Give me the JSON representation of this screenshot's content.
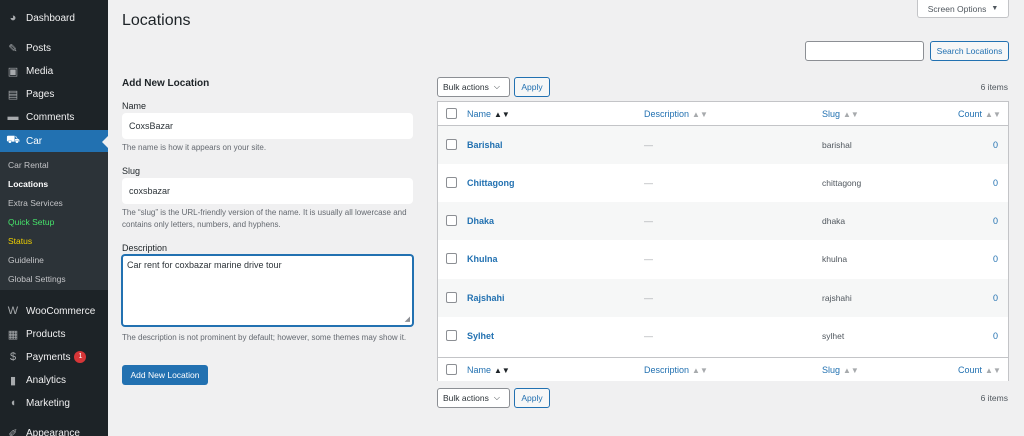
{
  "sidebar": {
    "menu": [
      {
        "label": "Dashboard",
        "icon": "dashboard-icon",
        "glyph": "◕"
      },
      {
        "label": "Posts",
        "icon": "pin-icon",
        "glyph": "✎"
      },
      {
        "label": "Media",
        "icon": "media-icon",
        "glyph": "▣"
      },
      {
        "label": "Pages",
        "icon": "pages-icon",
        "glyph": "▤"
      },
      {
        "label": "Comments",
        "icon": "comments-icon",
        "glyph": "▬"
      },
      {
        "label": "Car",
        "icon": "car-icon",
        "glyph": "⛟"
      }
    ],
    "submenu": [
      {
        "label": "Car Rental"
      },
      {
        "label": "Locations"
      },
      {
        "label": "Extra Services"
      },
      {
        "label": "Quick Setup"
      },
      {
        "label": "Status"
      },
      {
        "label": "Guideline"
      },
      {
        "label": "Global Settings"
      }
    ],
    "menu2": [
      {
        "label": "WooCommerce",
        "icon": "woocommerce-icon",
        "glyph": "W"
      },
      {
        "label": "Products",
        "icon": "products-icon",
        "glyph": "▦"
      },
      {
        "label": "Payments",
        "icon": "payments-icon",
        "glyph": "$",
        "badge": "1"
      },
      {
        "label": "Analytics",
        "icon": "analytics-icon",
        "glyph": "▮"
      },
      {
        "label": "Marketing",
        "icon": "marketing-icon",
        "glyph": "◖"
      },
      {
        "label": "Appearance",
        "icon": "appearance-icon",
        "glyph": "✐"
      }
    ]
  },
  "header": {
    "title": "Locations",
    "screen_options": "Screen Options",
    "search_button": "Search Locations"
  },
  "form": {
    "heading": "Add New Location",
    "name_label": "Name",
    "name_value": "CoxsBazar",
    "name_help": "The name is how it appears on your site.",
    "slug_label": "Slug",
    "slug_value": "coxsbazar",
    "slug_help": "The “slug” is the URL-friendly version of the name. It is usually all lowercase and contains only letters, numbers, and hyphens.",
    "description_label": "Description",
    "description_value": "Car rent for coxbazar marine drive tour",
    "description_help": "The description is not prominent by default; however, some themes may show it.",
    "submit_label": "Add New Location"
  },
  "table": {
    "bulk_actions": "Bulk actions",
    "apply": "Apply",
    "items_count": "6 items",
    "columns": {
      "name": "Name",
      "description": "Description",
      "slug": "Slug",
      "count": "Count"
    },
    "rows": [
      {
        "name": "Barishal",
        "description": "—",
        "slug": "barishal",
        "count": "0"
      },
      {
        "name": "Chittagong",
        "description": "—",
        "slug": "chittagong",
        "count": "0"
      },
      {
        "name": "Dhaka",
        "description": "—",
        "slug": "dhaka",
        "count": "0"
      },
      {
        "name": "Khulna",
        "description": "—",
        "slug": "khulna",
        "count": "0"
      },
      {
        "name": "Rajshahi",
        "description": "—",
        "slug": "rajshahi",
        "count": "0"
      },
      {
        "name": "Sylhet",
        "description": "—",
        "slug": "sylhet",
        "count": "0"
      }
    ]
  },
  "colors": {
    "accent": "#2271b1",
    "sidebar": "#1d2327",
    "badge": "#d63638"
  }
}
